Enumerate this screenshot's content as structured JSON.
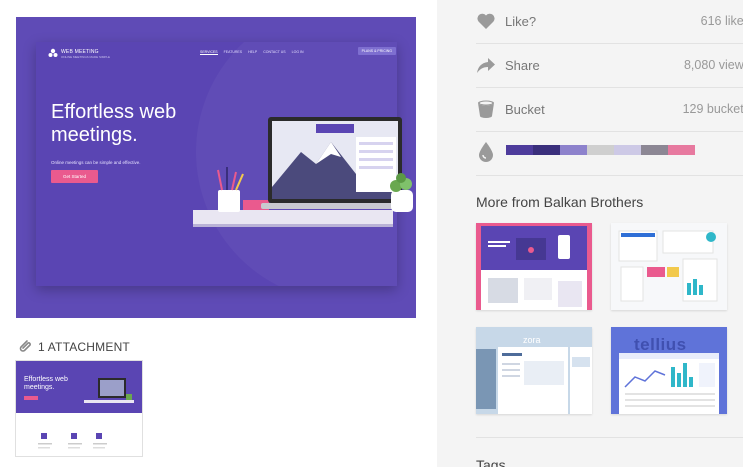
{
  "shot": {
    "brand": "WEB MEETING",
    "brand_sub": "ONLINE MEETINGS MADE SIMPLE",
    "nav": [
      "SERVICES",
      "FEATURES",
      "HELP",
      "CONTACT US",
      "LOG IN"
    ],
    "plans_btn": "PLANS & PRICING",
    "hero_title": "Effortless web meetings.",
    "hero_sub": "Online meetings can be simple and effective.",
    "hero_btn": "Get Started"
  },
  "attachment": {
    "label": "1 ATTACHMENT",
    "thumb_title": "Effortless web meetings."
  },
  "stats": [
    {
      "label": "Like?",
      "value": "616 likes",
      "icon": "heart-icon"
    },
    {
      "label": "Share",
      "value": "8,080 views",
      "icon": "share-arrow-icon"
    },
    {
      "label": "Bucket",
      "value": "129 buckets",
      "icon": "bucket-icon"
    }
  ],
  "palette": {
    "icon": "color-drop-icon",
    "colors": [
      "#4e3c9c",
      "#3a2f7c",
      "#8d82cc",
      "#cfcfcf",
      "#cdc9e6",
      "#8c8794",
      "#e7799f"
    ]
  },
  "more": {
    "title": "More from Balkan Brothers",
    "cards": [
      {
        "name": "web-meeting-shot"
      },
      {
        "name": "dashboard-app-shot"
      },
      {
        "name": "zora-shot",
        "label": "zora"
      },
      {
        "name": "tellius-shot",
        "label": "tellius"
      }
    ]
  },
  "tags": {
    "title": "Tags"
  },
  "colors": {
    "accent_purple": "#5a45b3",
    "accent_pink": "#ea5a8e",
    "sidebar_bg": "#f4f4f4"
  }
}
